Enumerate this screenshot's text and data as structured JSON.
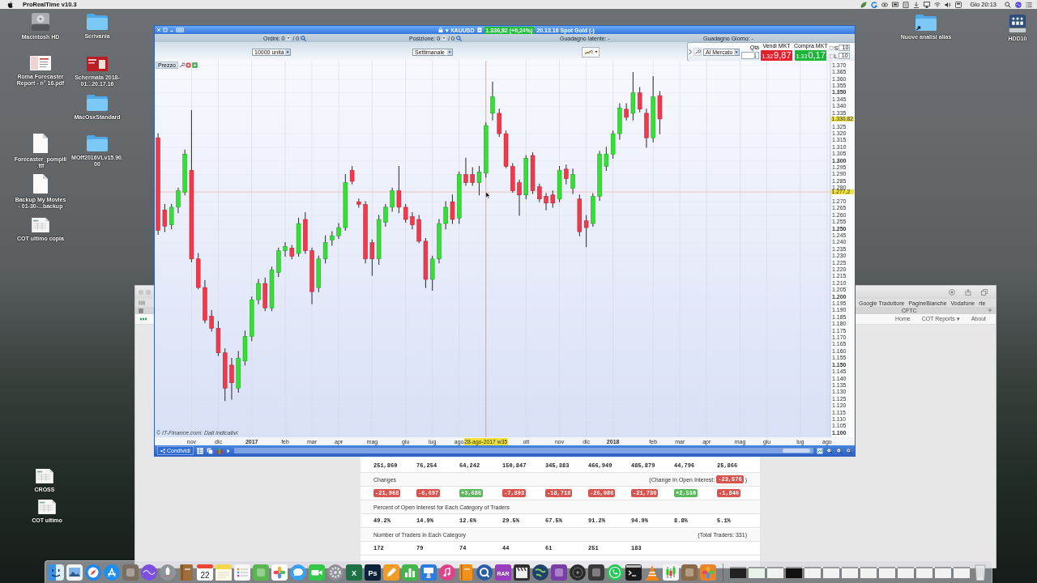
{
  "menu_bar": {
    "app_name": "ProRealTime v10.3",
    "clock": "Gio 20:13"
  },
  "desktop_icons": [
    {
      "kind": "drive",
      "label": "Macintosh HD"
    },
    {
      "kind": "folder",
      "label": "Scrivania"
    },
    {
      "kind": "pdf",
      "label": "Roma Forecaster Report - n° 16.pdf"
    },
    {
      "kind": "screenshot",
      "label": "Schermata 2018-01...20.17.16"
    },
    {
      "kind": "folder",
      "label": "MacOsxStandard"
    },
    {
      "kind": "document",
      "label": "Forecaster_pompili.ttf"
    },
    {
      "kind": "folder",
      "label": "MOff2016VLv15.90.00"
    },
    {
      "kind": "document",
      "label": "Backup My Movies - 01-30-...backup"
    },
    {
      "kind": "spreadsheet",
      "label": "COT ultimo copia"
    },
    {
      "kind": "spreadsheet",
      "label": "CROSS"
    },
    {
      "kind": "spreadsheet",
      "label": "COT ultimo"
    },
    {
      "kind": "folder-alias",
      "label": "Nuove analisi alias"
    },
    {
      "kind": "network-drive",
      "label": "HDD10"
    }
  ],
  "browser_window": {
    "bookmarks": [
      "Google Traduttore",
      "PagineBianche",
      "Vodafone",
      "rte"
    ],
    "tab_title": "CFTC",
    "nav": [
      "Home",
      "COT Reports ▾",
      "About"
    ],
    "cot_table": {
      "rows": [
        {
          "kind": "values",
          "cells": [
            "251,860",
            "76,254",
            "64,242",
            "150,847",
            "345,383",
            "466,949",
            "485,879",
            "44,796",
            "25,866"
          ]
        },
        {
          "kind": "heading",
          "label": "Changes",
          "note": "(Change In Open Interest:",
          "note_badge": {
            "text": "-23,576",
            "color": "#d9534f"
          },
          "note_end": ")"
        },
        {
          "kind": "badges",
          "cells": [
            {
              "text": "-21,968",
              "color": "#d9534f"
            },
            {
              "text": "-6,697",
              "color": "#d9534f"
            },
            {
              "text": "+3,685",
              "color": "#5cb85c"
            },
            {
              "text": "-7,803",
              "color": "#d9534f"
            },
            {
              "text": "-18,718",
              "color": "#d9534f"
            },
            {
              "text": "-26,086",
              "color": "#d9534f"
            },
            {
              "text": "-21,730",
              "color": "#d9534f"
            },
            {
              "text": "+2,510",
              "color": "#5cb85c"
            },
            {
              "text": "-1,846",
              "color": "#d9534f"
            }
          ]
        },
        {
          "kind": "heading",
          "label": "Percent of Open Interest for Each Category of Traders"
        },
        {
          "kind": "values",
          "cells": [
            "49.2%",
            "14.9%",
            "12.6%",
            "29.5%",
            "67.5%",
            "91.2%",
            "94.9%",
            "8.8%",
            "5.1%"
          ]
        },
        {
          "kind": "heading",
          "label": "Number of Traders in Each Category",
          "note": "(Total Traders: 331)"
        },
        {
          "kind": "values",
          "cells": [
            "172",
            "79",
            "74",
            "44",
            "61",
            "251",
            "183"
          ]
        }
      ]
    }
  },
  "chart_window": {
    "title_bar": {
      "symbol": "▾ XAUUSD",
      "price_change": "1.330,82 (+0,24%)",
      "description": "20.13.16 Spot Gold (-)"
    },
    "account_bar": [
      {
        "kind": "counter",
        "label": "Ordini: 0",
        "total": "/ 0"
      },
      {
        "kind": "counter",
        "label": "Posizione: 0",
        "total": "/ 0"
      },
      {
        "kind": "text",
        "label": "Guadagno latente: -"
      },
      {
        "kind": "text",
        "label": "Guadagno Giorno: -"
      }
    ],
    "quantity_select": "10000 unità",
    "period_select": "Settimanale",
    "order_ticket": {
      "order_type": "Al Mercato",
      "qty_label": "Qtà",
      "qty": "1",
      "actions": [
        {
          "kind": "sell",
          "label": "Vendi MKT",
          "price_prefix": "1.32",
          "price": "9,87"
        },
        {
          "kind": "buy",
          "label": "Compra MKT",
          "price_prefix": "1.33",
          "price": "0,17"
        }
      ],
      "options": [
        {
          "label": "S",
          "checked": false,
          "value": "10"
        },
        {
          "label": "L",
          "checked": false,
          "value": "10"
        }
      ]
    },
    "price_panel": {
      "title": "Prezzo",
      "footer": "© IT-Finance.com: Dati indicativi",
      "chart_data": {
        "type": "candlestick",
        "grid": true,
        "ylim": [
          1.097,
          1.3736
        ],
        "categories": [
          null,
          null,
          null,
          null,
          null,
          "nov",
          null,
          null,
          null,
          "dic",
          null,
          null,
          null,
          null,
          "2017",
          null,
          null,
          null,
          null,
          "feb",
          null,
          null,
          null,
          "mar",
          null,
          null,
          null,
          "apr",
          null,
          null,
          null,
          null,
          "mag",
          null,
          null,
          null,
          null,
          "giu",
          null,
          null,
          null,
          "lug",
          null,
          null,
          null,
          "ago",
          null,
          null,
          null,
          "28-ago-2017 w35",
          null,
          null,
          null,
          null,
          null,
          "ott",
          null,
          null,
          null,
          null,
          "nov",
          null,
          null,
          null,
          "dic",
          null,
          null,
          null,
          "2018",
          null,
          null,
          null,
          null,
          null,
          "feb",
          null,
          null,
          null,
          "mar",
          null,
          null,
          null,
          "apr",
          null,
          null,
          null,
          null,
          "mag",
          null,
          null,
          null,
          "giu",
          null,
          null,
          null,
          null,
          "lug",
          null,
          null,
          null,
          "ago"
        ],
        "ohlc": [
          [
            1.317,
            1.32,
            1.246,
            1.249
          ],
          [
            1.264,
            1.268,
            1.248,
            1.252
          ],
          [
            1.253,
            1.268,
            1.25,
            1.266
          ],
          [
            1.266,
            1.28,
            1.262,
            1.278
          ],
          [
            1.277,
            1.308,
            1.275,
            1.305
          ],
          [
            1.293,
            1.337,
            1.226,
            1.228
          ],
          [
            1.228,
            1.232,
            1.206,
            1.207
          ],
          [
            1.207,
            1.212,
            1.181,
            1.183
          ],
          [
            1.186,
            1.19,
            1.175,
            1.177
          ],
          [
            1.177,
            1.182,
            1.157,
            1.159
          ],
          [
            1.159,
            1.162,
            1.124,
            1.133
          ],
          [
            1.15,
            1.155,
            1.125,
            1.137
          ],
          [
            1.133,
            1.16,
            1.13,
            1.155
          ],
          [
            1.153,
            1.175,
            1.15,
            1.171
          ],
          [
            1.171,
            1.2,
            1.168,
            1.198
          ],
          [
            1.198,
            1.213,
            1.195,
            1.21
          ],
          [
            1.21,
            1.214,
            1.19,
            1.192
          ],
          [
            1.192,
            1.222,
            1.19,
            1.22
          ],
          [
            1.218,
            1.236,
            1.215,
            1.234
          ],
          [
            1.234,
            1.24,
            1.23,
            1.237
          ],
          [
            1.236,
            1.238,
            1.228,
            1.23
          ],
          [
            1.232,
            1.258,
            1.23,
            1.254
          ],
          [
            1.257,
            1.262,
            1.232,
            1.234
          ],
          [
            1.234,
            1.236,
            1.195,
            1.204
          ],
          [
            1.207,
            1.23,
            1.204,
            1.228
          ],
          [
            1.228,
            1.245,
            1.225,
            1.24
          ],
          [
            1.242,
            1.248,
            1.238,
            1.245
          ],
          [
            1.245,
            1.254,
            1.243,
            1.251
          ],
          [
            1.251,
            1.29,
            1.249,
            1.284
          ],
          [
            1.293,
            1.296,
            1.283,
            1.285
          ],
          [
            1.27,
            1.272,
            1.266,
            1.268
          ],
          [
            1.268,
            1.27,
            1.225,
            1.228
          ],
          [
            1.24,
            1.242,
            1.216,
            1.228
          ],
          [
            1.228,
            1.26,
            1.224,
            1.257
          ],
          [
            1.255,
            1.268,
            1.252,
            1.266
          ],
          [
            1.266,
            1.28,
            1.263,
            1.278
          ],
          [
            1.278,
            1.296,
            1.262,
            1.266
          ],
          [
            1.266,
            1.268,
            1.255,
            1.257
          ],
          [
            1.259,
            1.262,
            1.25,
            1.253
          ],
          [
            1.257,
            1.26,
            1.24,
            1.241
          ],
          [
            1.241,
            1.243,
            1.207,
            1.213
          ],
          [
            1.213,
            1.23,
            1.205,
            1.228
          ],
          [
            1.228,
            1.257,
            1.225,
            1.254
          ],
          [
            1.254,
            1.27,
            1.25,
            1.266
          ],
          [
            1.27,
            1.275,
            1.254,
            1.257
          ],
          [
            1.258,
            1.292,
            1.254,
            1.29
          ],
          [
            1.29,
            1.302,
            1.282,
            1.284
          ],
          [
            1.29,
            1.295,
            1.282,
            1.284
          ],
          [
            1.284,
            1.296,
            1.275,
            1.292
          ],
          [
            1.291,
            1.328,
            1.288,
            1.326
          ],
          [
            1.335,
            1.358,
            1.33,
            1.347
          ],
          [
            1.335,
            1.338,
            1.318,
            1.32
          ],
          [
            1.32,
            1.322,
            1.295,
            1.296
          ],
          [
            1.296,
            1.298,
            1.277,
            1.278
          ],
          [
            1.284,
            1.286,
            1.26,
            1.275
          ],
          [
            1.275,
            1.304,
            1.272,
            1.302
          ],
          [
            1.304,
            1.306,
            1.276,
            1.278
          ],
          [
            1.281,
            1.283,
            1.27,
            1.272
          ],
          [
            1.274,
            1.276,
            1.264,
            1.269
          ],
          [
            1.275,
            1.278,
            1.266,
            1.269
          ],
          [
            1.272,
            1.296,
            1.27,
            1.293
          ],
          [
            1.294,
            1.297,
            1.283,
            1.287
          ],
          [
            1.28,
            1.294,
            1.276,
            1.29
          ],
          [
            1.272,
            1.275,
            1.245,
            1.248
          ],
          [
            1.256,
            1.26,
            1.237,
            1.251
          ],
          [
            1.254,
            1.276,
            1.252,
            1.274
          ],
          [
            1.274,
            1.307,
            1.271,
            1.305
          ],
          [
            1.296,
            1.31,
            1.293,
            1.305
          ],
          [
            1.305,
            1.322,
            1.302,
            1.32
          ],
          [
            1.32,
            1.342,
            1.316,
            1.339
          ],
          [
            1.338,
            1.342,
            1.33,
            1.332
          ],
          [
            1.335,
            1.365,
            1.33,
            1.35
          ],
          [
            1.35,
            1.354,
            1.336,
            1.338
          ],
          [
            1.335,
            1.338,
            1.31,
            1.317
          ],
          [
            1.317,
            1.362,
            1.314,
            1.347
          ],
          [
            1.348,
            1.351,
            1.32,
            1.33082
          ],
          null,
          null,
          null,
          null,
          null,
          null,
          null,
          null,
          null,
          null,
          null,
          null,
          null,
          null,
          null,
          null,
          null,
          null,
          null,
          null,
          null,
          null,
          null,
          null,
          null
        ],
        "yticks": [
          {
            "value": 1.37,
            "label": "1.370"
          },
          {
            "value": 1.365,
            "label": "1.365"
          },
          {
            "value": 1.36,
            "label": "1.360"
          },
          {
            "value": 1.355,
            "label": "1.355"
          },
          {
            "value": 1.35,
            "label": "1.350"
          },
          {
            "value": 1.345,
            "label": "1.345"
          },
          {
            "value": 1.34,
            "label": "1.340"
          },
          {
            "value": 1.335,
            "label": "1.335"
          },
          {
            "value": 1.325,
            "label": "1.325"
          },
          {
            "value": 1.32,
            "label": "1.320"
          },
          {
            "value": 1.315,
            "label": "1.315"
          },
          {
            "value": 1.31,
            "label": "1.310"
          },
          {
            "value": 1.305,
            "label": "1.305"
          },
          {
            "value": 1.3,
            "label": "1.300"
          },
          {
            "value": 1.295,
            "label": "1.295"
          },
          {
            "value": 1.29,
            "label": "1.290"
          },
          {
            "value": 1.285,
            "label": "1.285"
          },
          {
            "value": 1.28,
            "label": "1.280"
          },
          {
            "value": 1.27,
            "label": "1.270"
          },
          {
            "value": 1.265,
            "label": "1.265"
          },
          {
            "value": 1.26,
            "label": "1.260"
          },
          {
            "value": 1.255,
            "label": "1.255"
          },
          {
            "value": 1.25,
            "label": "1.250"
          },
          {
            "value": 1.245,
            "label": "1.245"
          },
          {
            "value": 1.24,
            "label": "1.240"
          },
          {
            "value": 1.235,
            "label": "1.235"
          },
          {
            "value": 1.23,
            "label": "1.230"
          },
          {
            "value": 1.225,
            "label": "1.225"
          },
          {
            "value": 1.22,
            "label": "1.220"
          },
          {
            "value": 1.215,
            "label": "1.215"
          },
          {
            "value": 1.21,
            "label": "1.210"
          },
          {
            "value": 1.205,
            "label": "1.205"
          },
          {
            "value": 1.2,
            "label": "1.200"
          },
          {
            "value": 1.195,
            "label": "1.195"
          },
          {
            "value": 1.19,
            "label": "1.190"
          },
          {
            "value": 1.185,
            "label": "1.185"
          },
          {
            "value": 1.18,
            "label": "1.180"
          },
          {
            "value": 1.175,
            "label": "1.175"
          },
          {
            "value": 1.17,
            "label": "1.170"
          },
          {
            "value": 1.165,
            "label": "1.165"
          },
          {
            "value": 1.16,
            "label": "1.160"
          },
          {
            "value": 1.155,
            "label": "1.155"
          },
          {
            "value": 1.15,
            "label": "1.150"
          },
          {
            "value": 1.145,
            "label": "1.145"
          },
          {
            "value": 1.14,
            "label": "1.140"
          },
          {
            "value": 1.135,
            "label": "1.135"
          },
          {
            "value": 1.13,
            "label": "1.130"
          },
          {
            "value": 1.125,
            "label": "1.125"
          },
          {
            "value": 1.12,
            "label": "1.120"
          },
          {
            "value": 1.115,
            "label": "1.115"
          },
          {
            "value": 1.11,
            "label": "1.110"
          },
          {
            "value": 1.105,
            "label": "1.105"
          },
          {
            "value": 1.1,
            "label": "1.100"
          }
        ],
        "ref_lines": [
          {
            "axis": "x",
            "value": "28-ago-2017 w35"
          },
          {
            "axis": "y",
            "value": 1.2772,
            "label": "1.277,2"
          }
        ],
        "annotations": [
          "1.330,82"
        ]
      }
    },
    "bottom_bar": {
      "share_button": "Condividi"
    }
  },
  "dock": [
    {
      "kind": "face",
      "color": "#3b8fe6"
    },
    {
      "kind": "photo",
      "color": "#7fb2e8"
    },
    {
      "kind": "compass",
      "color": "#1f86f0"
    },
    {
      "kind": "sticks",
      "color": "#1c8ef2"
    },
    {
      "kind": "tile",
      "color": "#7a6e62"
    },
    {
      "kind": "orb",
      "color": "#7d4fe0"
    },
    {
      "kind": "rocket",
      "color": "#8e949c"
    },
    {
      "kind": "book",
      "color": "#a06c3a"
    },
    {
      "kind": "calendar",
      "text": "22"
    },
    {
      "kind": "note",
      "color": "#f6d64a"
    },
    {
      "kind": "list",
      "color": "#f7f7f7"
    },
    {
      "kind": "tile",
      "color": "#5ab552"
    },
    {
      "kind": "flower",
      "color": "#ffffff"
    },
    {
      "kind": "bubble",
      "color": "#3aa0f6"
    },
    {
      "kind": "camera",
      "color": "#35c64a"
    },
    {
      "kind": "gear",
      "color": "#8d8f93"
    },
    {
      "kind": "letter",
      "color": "#1f7245",
      "text": "X"
    },
    {
      "kind": "letter",
      "color": "#0b2338",
      "text": "Ps"
    },
    {
      "kind": "pen",
      "color": "#f29b26"
    },
    {
      "kind": "bars",
      "color": "#41b649"
    },
    {
      "kind": "podium",
      "color": "#2b7be0"
    },
    {
      "kind": "music",
      "color": "#e0418a"
    },
    {
      "kind": "book",
      "color": "#f2901c"
    },
    {
      "kind": "ring",
      "color": "#2a5ca8"
    },
    {
      "kind": "letter",
      "color": "#9a3cc0",
      "text": "RAR"
    },
    {
      "kind": "clapper",
      "color": "#2f2f2f"
    },
    {
      "kind": "globe",
      "color": "#23406a"
    },
    {
      "kind": "tile",
      "color": "#7a3da6"
    },
    {
      "kind": "disc",
      "color": "#2a2a2a"
    },
    {
      "kind": "tile",
      "color": "#3a3a3a"
    },
    {
      "kind": "phone",
      "color": "#25c65a"
    },
    {
      "kind": "terminal",
      "color": "#1b1b1b"
    },
    {
      "kind": "cone",
      "color": "#f2861a"
    },
    {
      "kind": "candles",
      "color": "#f4f4f4"
    },
    {
      "kind": "tile",
      "color": "#8b6a48"
    },
    {
      "kind": "flower",
      "color": "#e8842a"
    },
    {
      "kind": "separator"
    },
    {
      "kind": "thumbnail",
      "color": "#222222"
    },
    {
      "kind": "thumbnail",
      "color": "#e9f3ea"
    },
    {
      "kind": "thumbnail",
      "color": "#f2f2f2"
    },
    {
      "kind": "thumbnail",
      "color": "#111111"
    },
    {
      "kind": "thumbnail",
      "color": "#f2f2f2"
    },
    {
      "kind": "thumbnail",
      "color": "#f2f2f2"
    },
    {
      "kind": "thumbnail",
      "color": "#f2f2f2"
    },
    {
      "kind": "thumbnail",
      "color": "#f2f2f2"
    },
    {
      "kind": "thumbnail",
      "color": "#f2f2f2"
    },
    {
      "kind": "thumbnail",
      "color": "#f2f2f2"
    },
    {
      "kind": "thumbnail",
      "color": "#f2f2f2"
    },
    {
      "kind": "thumbnail",
      "color": "#f2f2f2"
    },
    {
      "kind": "thumbnail",
      "color": "#f2f2f2"
    },
    {
      "kind": "trash"
    }
  ]
}
